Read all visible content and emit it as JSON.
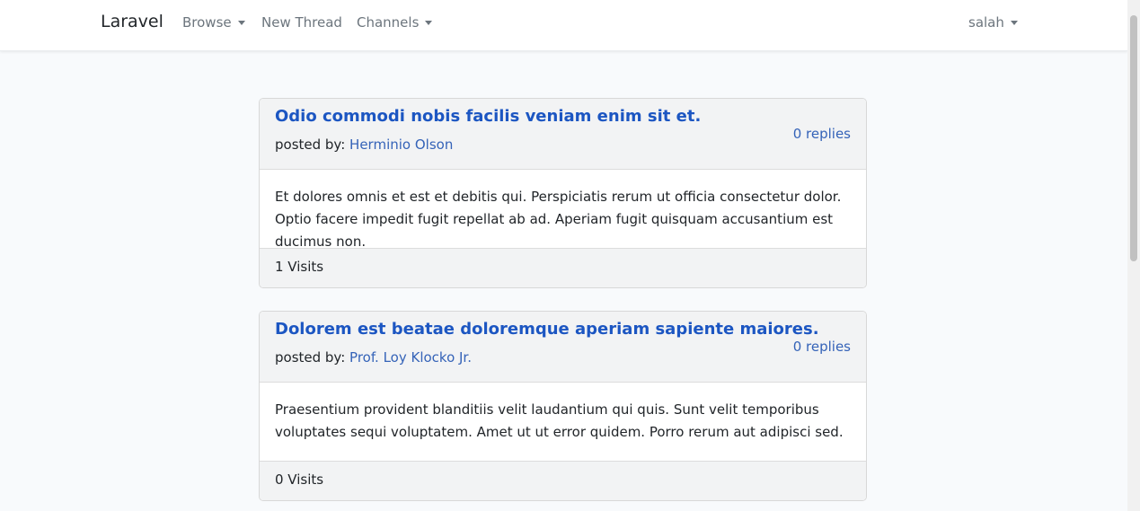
{
  "navbar": {
    "brand": "Laravel",
    "browse": "Browse",
    "new_thread": "New Thread",
    "channels": "Channels",
    "user": "salah"
  },
  "labels": {
    "posted_by": "posted by: "
  },
  "threads": [
    {
      "title": "Odio commodi nobis facilis veniam enim sit et.",
      "author": "Herminio Olson",
      "replies": "0 replies",
      "body": "Et dolores omnis et est et debitis qui. Perspiciatis rerum ut officia consectetur dolor. Optio facere impedit fugit repellat ab ad. Aperiam fugit quisquam accusantium est ducimus non.",
      "visits": "1 Visits"
    },
    {
      "title": "Dolorem est beatae doloremque aperiam sapiente maiores.",
      "author": "Prof. Loy Klocko Jr.",
      "replies": "0 replies",
      "body": "Praesentium provident blanditiis velit laudantium qui quis. Sunt velit temporibus voluptates sequi voluptatem. Amet ut ut error quidem. Porro rerum aut adipisci sed.",
      "visits": "0 Visits"
    }
  ]
}
